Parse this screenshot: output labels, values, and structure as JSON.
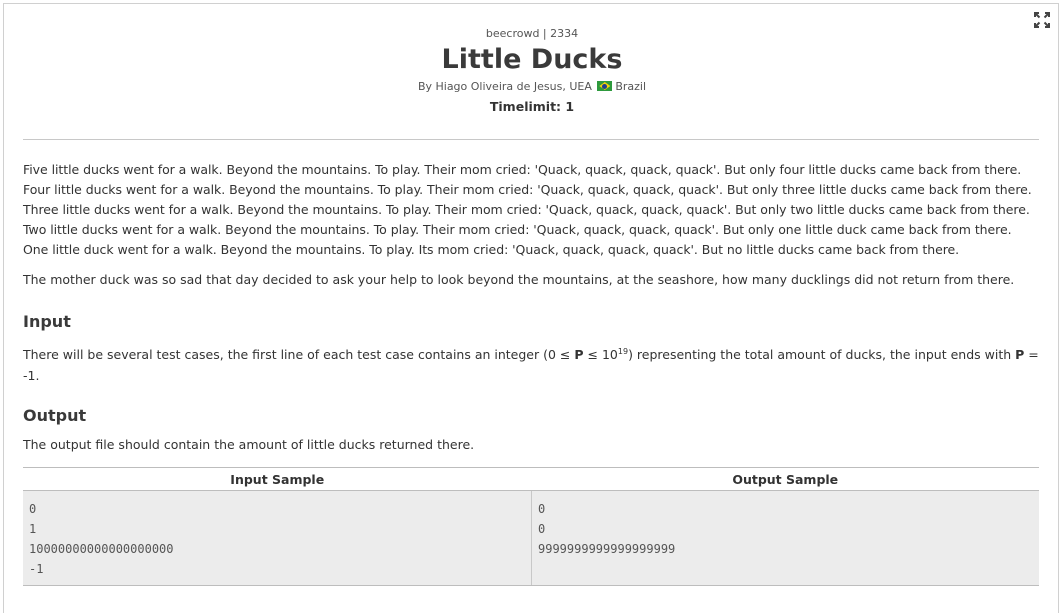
{
  "problem": {
    "source": "beecrowd | 2334",
    "title": "Little Ducks",
    "author_prefix": "By Hiago Oliveira de Jesus, UEA",
    "country": "Brazil",
    "timelimit_label": "Timelimit:",
    "timelimit_value": "1"
  },
  "icons": {
    "expand": "expand-icon",
    "flag": "brazil-flag-icon"
  },
  "description": {
    "story": [
      "Five little ducks went for a walk. Beyond the mountains. To play. Their mom cried: 'Quack, quack, quack, quack'. But only four little ducks came back from there.",
      "Four little ducks went for a walk. Beyond the mountains. To play. Their mom cried: 'Quack, quack, quack, quack'. But only three little ducks came back from there.",
      "Three little ducks went for a walk. Beyond the mountains. To play. Their mom cried: 'Quack, quack, quack, quack'. But only two little ducks came back from there.",
      "Two little ducks went for a walk. Beyond the mountains. To play. Their mom cried: 'Quack, quack, quack, quack'. But only one little duck came back from there.",
      "One little duck went for a walk. Beyond the mountains. To play. Its mom cried: 'Quack, quack, quack, quack'. But no little ducks came back from there."
    ],
    "paragraph": "The mother duck was so sad that day decided to ask your help to look beyond the mountains, at the seashore, how many ducklings did not return from there."
  },
  "input": {
    "heading": "Input",
    "text_before": "There will be several test cases, the first line of each test case contains an integer  (0 ≤ ",
    "var1": "P",
    "text_mid1": " ≤ 10",
    "exponent": "19",
    "text_mid2": ") representing the total amount of ducks, the input ends with ",
    "var2": "P",
    "text_end": " = -1."
  },
  "output": {
    "heading": "Output",
    "text": "The output file should contain the amount of little ducks returned there."
  },
  "samples": {
    "input_header": "Input Sample",
    "output_header": "Output Sample",
    "input_lines": [
      "0",
      "1",
      "10000000000000000000",
      "-1"
    ],
    "output_lines": [
      "0",
      "0",
      "9999999999999999999"
    ]
  }
}
